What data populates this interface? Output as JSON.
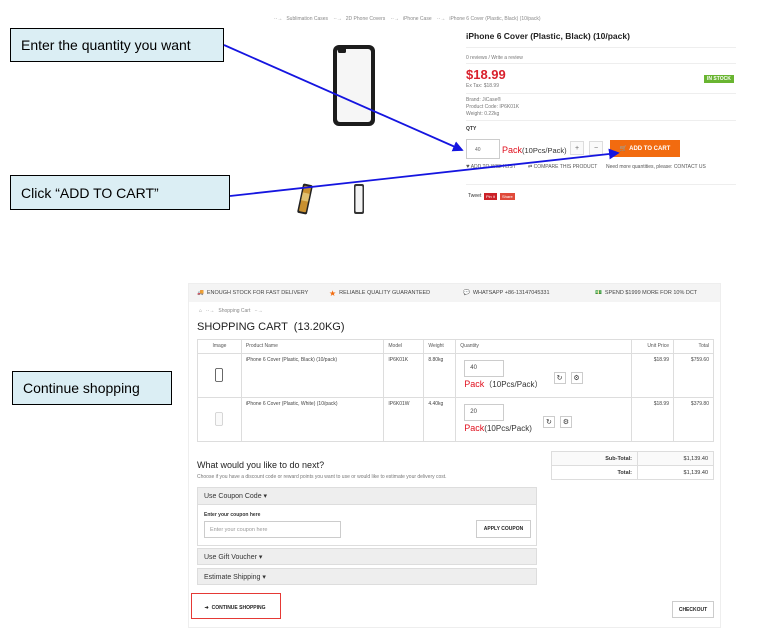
{
  "callouts": {
    "qty": "Enter the quantity you want",
    "add": "Click “ADD TO CART”",
    "continue": "Continue shopping"
  },
  "product": {
    "breadcrumb": [
      "Sublimation Cases",
      "2D Phone Covers",
      "iPhone Case",
      "iPhone 6 Cover (Plastic, Black) (10/pack)"
    ],
    "title": "iPhone 6 Cover (Plastic, Black) (10/pack)",
    "reviews": "0 reviews / Write a review",
    "price": "$18.99",
    "ex_tax": "Ex Tax: $18.99",
    "stock_badge": "IN STOCK",
    "brand": "Brand: JiCase®",
    "code": "Product Code: IP6K01K",
    "weight": "Weight: 0.22kg",
    "qty_label": "QTY",
    "qty_value": "40",
    "pack_label": "Pack",
    "pack_unit": "(10Pcs/Pack)",
    "plus": "+",
    "minus": "−",
    "add_to_cart": "ADD TO CART",
    "wishlist": "ADD TO WISH LIST",
    "compare": "COMPARE THIS PRODUCT",
    "need_more": "Need more quantities, please: CONTACT US",
    "tweet": "Tweet",
    "pinit": "Pin it",
    "share": "Share"
  },
  "cart": {
    "topbar": [
      "ENOUGH STOCK FOR FAST DELIVERY",
      "RELIABLE QUALITY GUARANTEED",
      "WHATSAPP +86-13147045331",
      "SPEND $1999 MORE FOR 10% DCT"
    ],
    "breadcrumb": "Shopping Cart",
    "title": "SHOPPING CART  (13.20KG)",
    "headers": [
      "Image",
      "Product Name",
      "Model",
      "Weight",
      "Quantity",
      "Unit Price",
      "Total"
    ],
    "rows": [
      {
        "name": "iPhone 6 Cover (Plastic, Black) (10/pack)",
        "model": "IP6K01K",
        "weight": "8.80kg",
        "qty": "40",
        "pack": "Pack",
        "unit": "（10Pcs/Pack）",
        "price": "$18.99",
        "total": "$759.60"
      },
      {
        "name": "iPhone 6 Cover (Plastic, White) (10/pack)",
        "model": "IP6K01W",
        "weight": "4.40kg",
        "qty": "20",
        "pack": "Pack",
        "unit": "(10Pcs/Pack)",
        "price": "$18.99",
        "total": "$379.80"
      }
    ],
    "next_title": "What would you like to do next?",
    "next_desc": "Choose if you have a discount code or reward points you want to use or would like to estimate your delivery cost.",
    "coupon_label": "Use Coupon Code ▾",
    "coupon_enter": "Enter your coupon here",
    "coupon_placeholder": "Enter your coupon here",
    "apply": "APPLY COUPON",
    "voucher": "Use Gift Voucher ▾",
    "shipping": "Estimate Shipping ▾",
    "subtotal_label": "Sub-Total:",
    "subtotal": "$1,139.40",
    "total_label": "Total:",
    "total": "$1,139.40",
    "continue": "CONTINUE SHOPPING",
    "checkout": "CHECKOUT"
  }
}
